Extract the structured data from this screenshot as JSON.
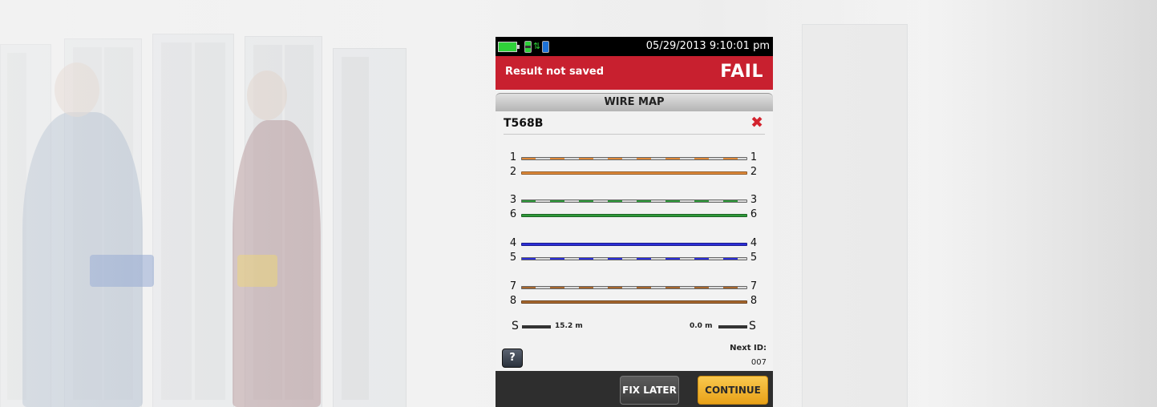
{
  "status_bar": {
    "datetime": "05/29/2013 9:10:01 pm",
    "icons": [
      "battery-icon",
      "remote-unit-icon",
      "link-arrows-icon",
      "phone-icon"
    ]
  },
  "result": {
    "note": "Result not saved",
    "status": "FAIL",
    "status_color": "#c8202f"
  },
  "screen": {
    "title": "WIRE MAP",
    "standard": "T568B",
    "result_icon": "fail-x-icon"
  },
  "wiremap": {
    "wires": [
      {
        "left_pin": "1",
        "right_pin": "1",
        "color": "#e08a3a",
        "stripe": true
      },
      {
        "left_pin": "2",
        "right_pin": "2",
        "color": "#e08a3a",
        "stripe": false
      },
      {
        "left_pin": "3",
        "right_pin": "3",
        "color": "#2e9a3a",
        "stripe": true
      },
      {
        "left_pin": "6",
        "right_pin": "6",
        "color": "#2e9a3a",
        "stripe": false
      },
      {
        "left_pin": "4",
        "right_pin": "4",
        "color": "#2c2ed8",
        "stripe": false
      },
      {
        "left_pin": "5",
        "right_pin": "5",
        "color": "#2c2ed8",
        "stripe": true
      },
      {
        "left_pin": "7",
        "right_pin": "7",
        "color": "#a8682e",
        "stripe": true
      },
      {
        "left_pin": "8",
        "right_pin": "8",
        "color": "#a8682e",
        "stripe": false
      }
    ],
    "shield": {
      "left_label": "S",
      "right_label": "S",
      "left_length": "15.2 m",
      "right_length": "0.0 m"
    }
  },
  "footer": {
    "help_label": "?",
    "next_id_label": "Next ID:",
    "next_id_value": "007"
  },
  "softkeys": {
    "fix_later": "FIX LATER",
    "continue": "CONTINUE"
  }
}
